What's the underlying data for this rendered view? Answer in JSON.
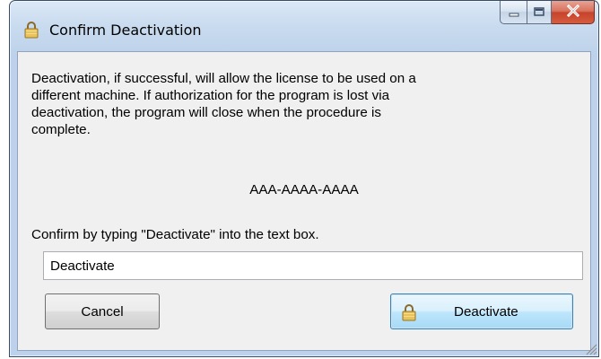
{
  "window": {
    "title": "Confirm Deactivation",
    "title_icon": "lock-icon",
    "caption_buttons": {
      "minimize_icon": "minimize-icon",
      "maximize_icon": "maximize-icon",
      "close_icon": "close-icon"
    }
  },
  "dialog": {
    "message": "Deactivation, if successful, will allow the license to be used on a\ndifferent machine.  If authorization for the program is lost via\ndeactivation, the program will close when the procedure is\ncomplete.",
    "license_code": "AAA-AAAA-AAAA",
    "instruction": "Confirm by typing \"Deactivate\" into the text box.",
    "confirm_input_value": "Deactivate"
  },
  "buttons": {
    "cancel_label": "Cancel",
    "deactivate_label": "Deactivate",
    "deactivate_icon": "lock-icon"
  },
  "colors": {
    "title_bar": "#c9dbef",
    "client_background": "#f0f0f0",
    "close_button": "#c7432b",
    "default_button_border": "#3c7fb1"
  }
}
